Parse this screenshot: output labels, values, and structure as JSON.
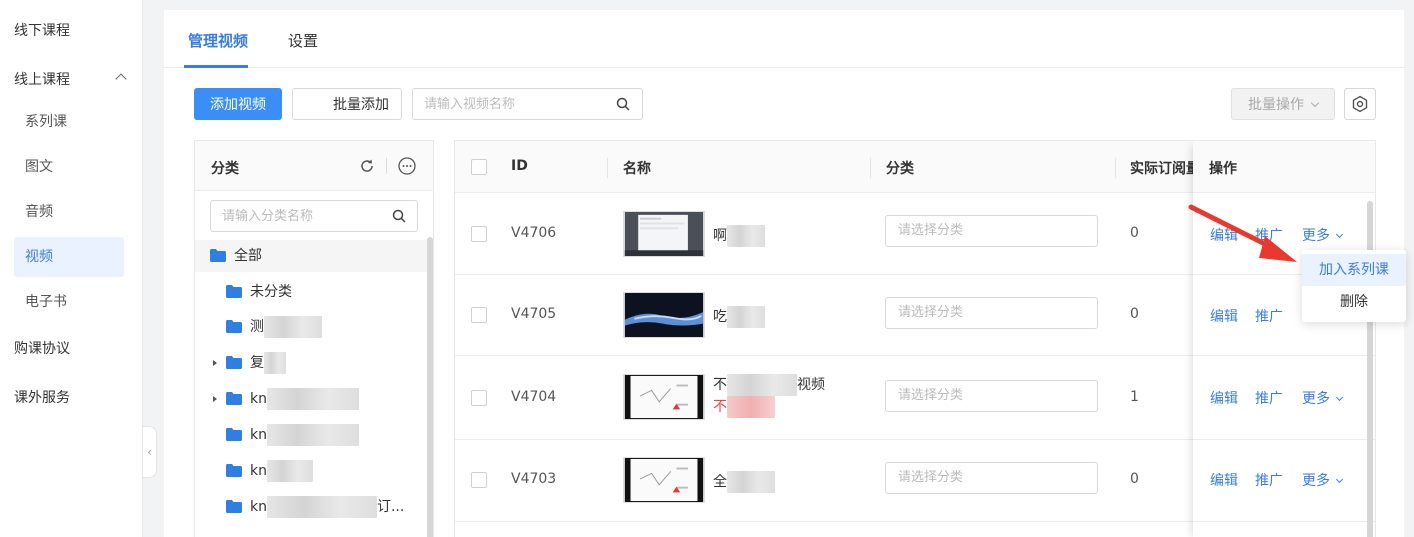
{
  "sidebar": {
    "items": [
      {
        "label": "线下课程"
      },
      {
        "label": "线上课程"
      },
      {
        "label": "系列课"
      },
      {
        "label": "图文"
      },
      {
        "label": "音频"
      },
      {
        "label": "视频"
      },
      {
        "label": "电子书"
      },
      {
        "label": "购课协议"
      },
      {
        "label": "课外服务"
      }
    ]
  },
  "tabs": [
    {
      "label": "管理视频"
    },
    {
      "label": "设置"
    }
  ],
  "toolbar": {
    "add_label": "添加视频",
    "batch_add_label": "批量添加",
    "search_placeholder": "请输入视频名称",
    "batch_ops_label": "批量操作"
  },
  "category_panel": {
    "title": "分类",
    "search_placeholder": "请输入分类名称",
    "tree": [
      {
        "label": "全部"
      },
      {
        "label": "未分类"
      },
      {
        "label": "测"
      },
      {
        "label": "复"
      },
      {
        "label": "kn"
      },
      {
        "label": "kn"
      },
      {
        "label": "kn"
      },
      {
        "label": "kn",
        "suffix": "订..."
      }
    ]
  },
  "table": {
    "columns": {
      "id": "ID",
      "name": "名称",
      "category": "分类",
      "subscriptions": "实际订阅量",
      "ops": "操作"
    },
    "rows": [
      {
        "id": "V4706",
        "name": "啊",
        "category_placeholder": "请选择分类",
        "subs": "0"
      },
      {
        "id": "V4705",
        "name": "吃",
        "category_placeholder": "请选择分类",
        "subs": "0"
      },
      {
        "id": "V4704",
        "name": "不",
        "name_suffix": "视频",
        "name_line2": "不",
        "category_placeholder": "请选择分类",
        "subs": "1"
      },
      {
        "id": "V4703",
        "name": "全",
        "category_placeholder": "请选择分类",
        "subs": "0"
      }
    ],
    "ops": {
      "edit": "编辑",
      "promote": "推广",
      "more": "更多"
    }
  },
  "dropdown": {
    "items": [
      {
        "label": "加入系列课"
      },
      {
        "label": "删除"
      }
    ]
  },
  "colors": {
    "accent": "#3a7dde",
    "primary_button": "#3a8ef6",
    "annotation_arrow": "#e8392f"
  }
}
